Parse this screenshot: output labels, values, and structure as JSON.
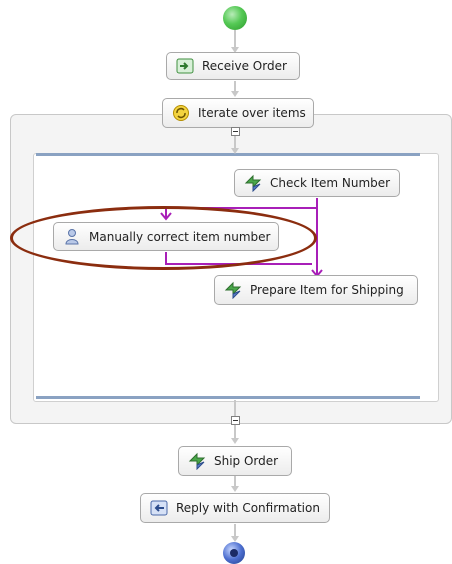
{
  "nodes": {
    "receive_order": "Receive Order",
    "iterate": "Iterate over items",
    "check_item": "Check Item Number",
    "manual_correct": "Manually correct item number",
    "prepare_item": "Prepare Item for Shipping",
    "ship_order": "Ship Order",
    "reply": "Reply with Confirmation"
  },
  "colors": {
    "flow_line": "#c8c8c8",
    "conditional_flow": "#a81fb8",
    "highlight": "#8b2d0f",
    "start": "#3fbf3f",
    "end": "#2f4fa8"
  },
  "icons": {
    "receive_order": "receive-icon",
    "iterate": "loop-icon",
    "check_item": "invoke-icon",
    "manual_correct": "human-task-icon",
    "prepare_item": "invoke-icon",
    "ship_order": "invoke-icon",
    "reply": "reply-icon"
  }
}
